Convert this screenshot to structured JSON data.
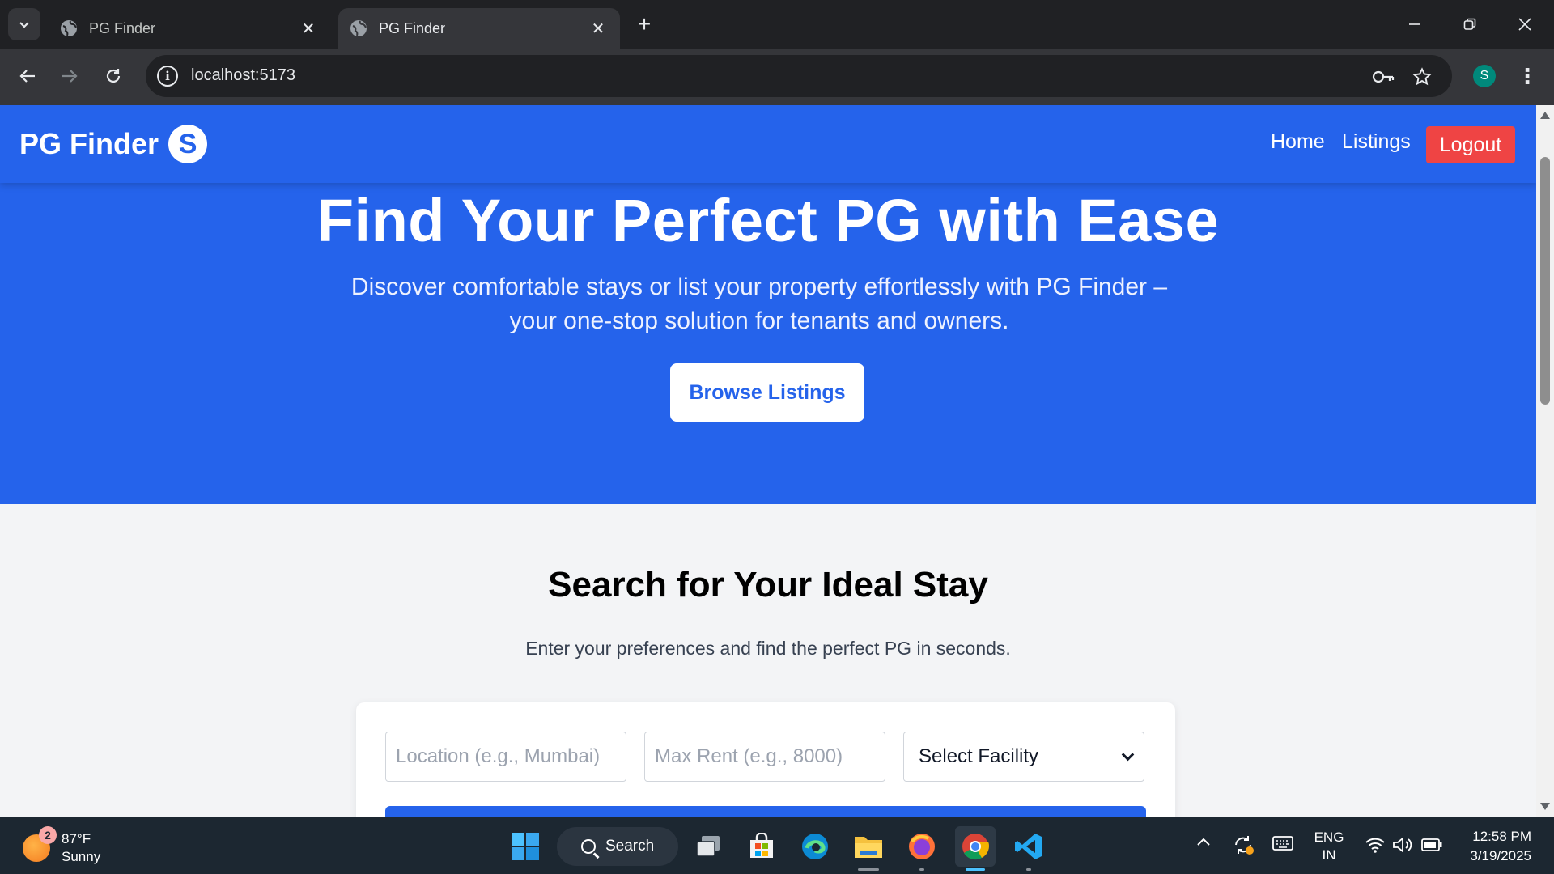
{
  "browser": {
    "tabs": [
      {
        "title": "PG Finder"
      },
      {
        "title": "PG Finder"
      }
    ],
    "url": "localhost:5173",
    "profile_initial": "S"
  },
  "nav": {
    "brand": "PG Finder",
    "brand_badge": "S",
    "links": [
      "Home",
      "Listings"
    ],
    "logout": "Logout"
  },
  "hero": {
    "title": "Find Your Perfect PG with Ease",
    "subtitle": "Discover comfortable stays or list your property effortlessly with PG Finder – your one-stop solution for tenants and owners.",
    "cta": "Browse Listings"
  },
  "search": {
    "title": "Search for Your Ideal Stay",
    "subtitle": "Enter your preferences and find the perfect PG in seconds.",
    "location_placeholder": "Location (e.g., Mumbai)",
    "rent_placeholder": "Max Rent (e.g., 8000)",
    "facility_selected": "Select Facility"
  },
  "taskbar": {
    "weather_badge": "2",
    "temperature": "87°F",
    "condition": "Sunny",
    "search_label": "Search",
    "lang_line1": "ENG",
    "lang_line2": "IN",
    "time": "12:58 PM",
    "date": "3/19/2025"
  },
  "colors": {
    "primary": "#2563eb",
    "logout": "#ef4444",
    "page_bg": "#f3f4f6"
  }
}
